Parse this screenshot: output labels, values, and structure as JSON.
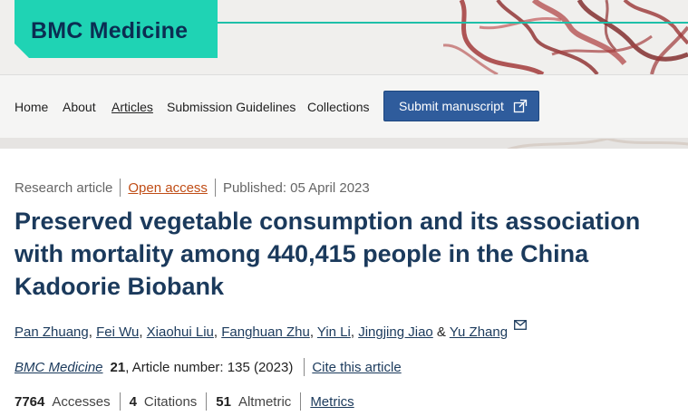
{
  "header": {
    "journal_logo": "BMC Medicine",
    "colors": {
      "accent": "#1fd3b4",
      "navy": "#0b2d52",
      "submit_bg": "#2f5c9c",
      "open_access": "#c04d16"
    }
  },
  "nav": {
    "items": [
      {
        "label": "Home"
      },
      {
        "label": "About"
      },
      {
        "label": "Articles",
        "active": true
      },
      {
        "label": "Submission Guidelines"
      },
      {
        "label": "Collections"
      }
    ],
    "submit_label": "Submit manuscript",
    "submit_icon": "external-link-icon"
  },
  "article": {
    "type": "Research article",
    "access": "Open access",
    "published": "Published: 05 April 2023",
    "title": "Preserved vegetable consumption and its association with mortality among 440,415 people in the China Kadoorie Biobank",
    "authors": [
      "Pan Zhuang",
      "Fei Wu",
      "Xiaohui Liu",
      "Fanghuan Zhu",
      "Yin Li",
      "Jingjing Jiao",
      "Yu Zhang"
    ],
    "author_separator": ", ",
    "author_last_joiner": " & ",
    "corresponding_icon": "mail-icon",
    "journal": "BMC Medicine",
    "volume": "21",
    "article_number": ", Article number: 135 (2023)",
    "cite_label": "Cite this article"
  },
  "metrics": {
    "accesses": {
      "value": "7764",
      "label": "Accesses"
    },
    "citations": {
      "value": "4",
      "label": "Citations"
    },
    "altmetric": {
      "value": "51",
      "label": "Altmetric"
    },
    "link_label": "Metrics"
  }
}
